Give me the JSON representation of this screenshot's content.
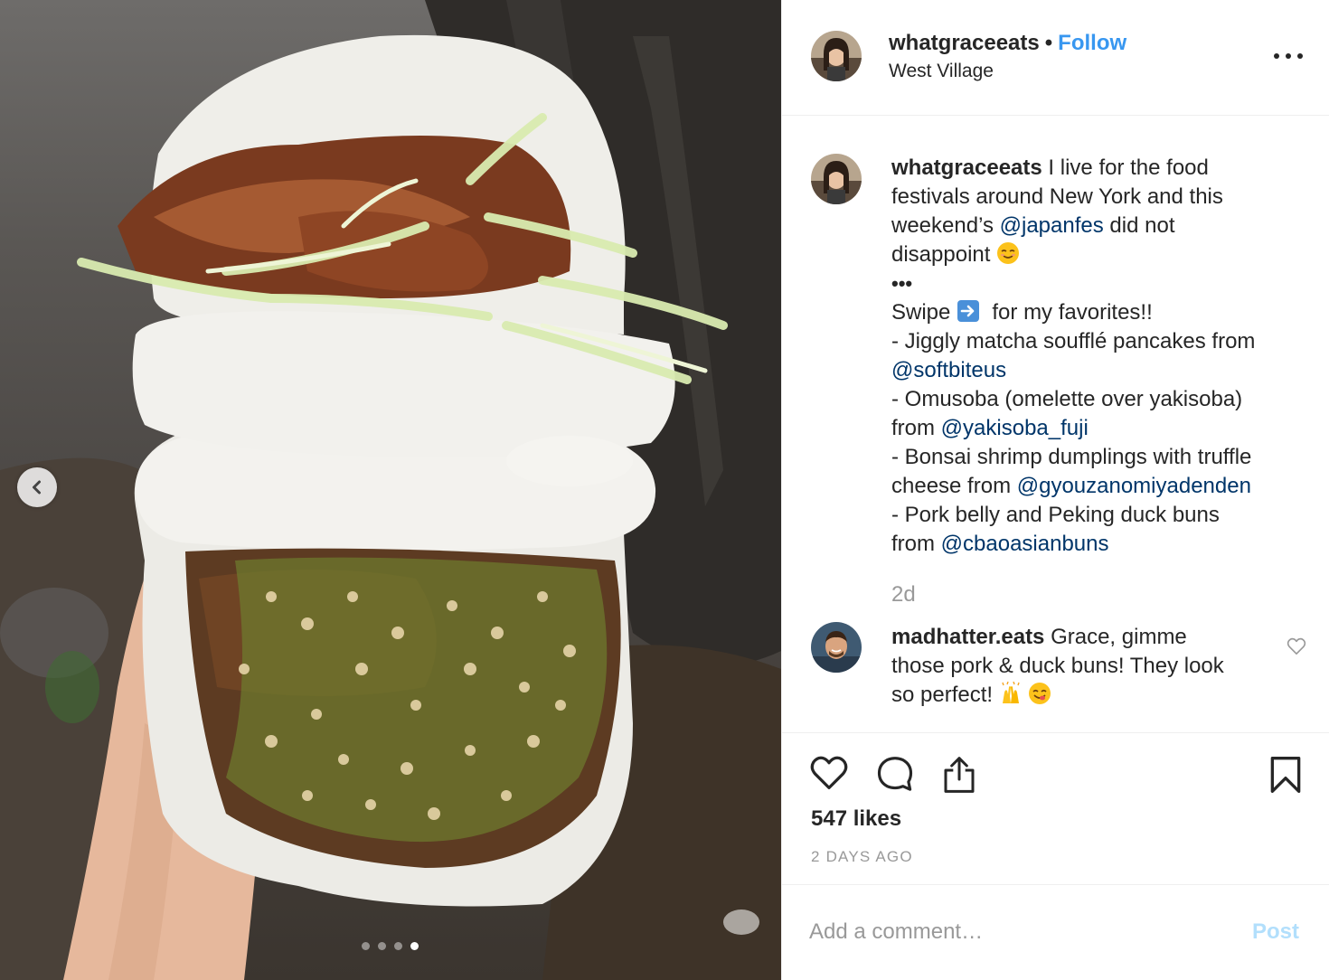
{
  "post": {
    "username": "whatgraceeats",
    "separator": "•",
    "follow_label": "Follow",
    "location": "West Village",
    "more_icon": "more-options-icon"
  },
  "caption": {
    "username": "whatgraceeats",
    "lines": [
      "I live for the food",
      "festivals around New York and this",
      "weekend’s",
      "@japanfes",
      "did not",
      "disappoint",
      "•••",
      "Swipe",
      "for my favorites!!",
      "- Jiggly matcha soufflé pancakes from",
      "@softbiteus",
      "- Omusoba (omelette over yakisoba)",
      "from",
      "@yakisoba_fuji",
      "- Bonsai shrimp dumplings with truffle",
      "cheese from",
      "@gyouzanomiyadenden",
      "- Pork belly and Peking duck buns",
      "from",
      "@cbaoasianbuns"
    ],
    "time": "2d"
  },
  "comment": {
    "username": "madhatter.eats",
    "lines": [
      "Grace, gimme",
      "those pork & duck buns! They look",
      "so perfect!"
    ]
  },
  "likes_label": "547 likes",
  "posted_ago": "2 DAYS AGO",
  "add_comment": {
    "placeholder": "Add a comment…",
    "post_label": "Post"
  },
  "carousel": {
    "total": 4,
    "active_index": 4
  },
  "colors": {
    "link": "#003569",
    "follow": "#3897f0",
    "muted": "#999999",
    "post_disabled": "#b2dffc",
    "text": "#262626"
  },
  "icons": [
    "chevron-left-icon",
    "heart-icon",
    "comment-icon",
    "share-icon",
    "bookmark-icon",
    "heart-small-icon",
    "smiling-face-emoji",
    "right-arrow-emoji",
    "raising-hands-emoji",
    "yum-face-emoji"
  ]
}
